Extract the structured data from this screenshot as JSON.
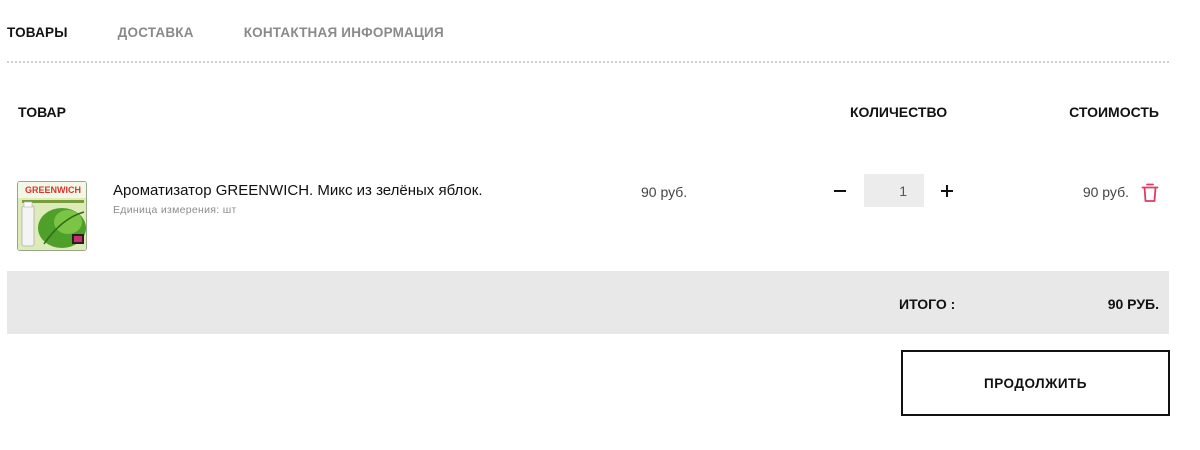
{
  "tabs": [
    {
      "label": "ТОВАРЫ",
      "active": true
    },
    {
      "label": "ДОСТАВКА",
      "active": false
    },
    {
      "label": "КОНТАКТНАЯ ИНФОРМАЦИЯ",
      "active": false
    }
  ],
  "table": {
    "headers": {
      "product": "ТОВАР",
      "quantity": "КОЛИЧЕСТВО",
      "cost": "СТОИМОСТЬ"
    }
  },
  "cart": {
    "items": [
      {
        "thumbnail_text": "GREENWICH",
        "name": "Ароматизатор GREENWICH. Микс из зелёных яблок.",
        "unit": "Единица измерения: шт",
        "price": "90 руб.",
        "quantity": "1",
        "total": "90 руб.",
        "minus_icon": "minus-icon",
        "plus_icon": "plus-icon",
        "delete_icon": "trash-icon"
      }
    ]
  },
  "summary": {
    "label": "ИТОГО :",
    "value": "90 РУБ."
  },
  "actions": {
    "continue_label": "ПРОДОЛЖИТЬ"
  },
  "colors": {
    "accent": "#e23a62",
    "total_bar": "#e8e8e8",
    "qty_bg": "#ececec"
  }
}
